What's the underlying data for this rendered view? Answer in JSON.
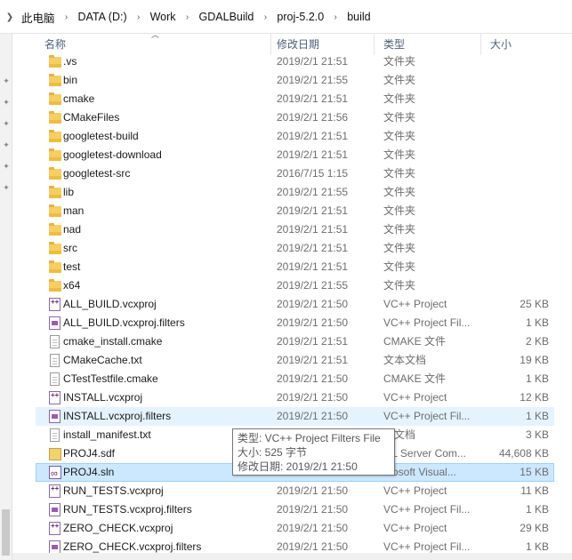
{
  "breadcrumb": {
    "items": [
      "此电脑",
      "DATA (D:)",
      "Work",
      "GDALBuild",
      "proj-5.2.0",
      "build"
    ]
  },
  "columns": {
    "name": "名称",
    "date": "修改日期",
    "type": "类型",
    "size": "大小"
  },
  "files": [
    {
      "name": ".vs",
      "date": "2019/2/1 21:51",
      "type": "文件夹",
      "size": "",
      "icon": "folder-icon"
    },
    {
      "name": "bin",
      "date": "2019/2/1 21:55",
      "type": "文件夹",
      "size": "",
      "icon": "folder-icon"
    },
    {
      "name": "cmake",
      "date": "2019/2/1 21:51",
      "type": "文件夹",
      "size": "",
      "icon": "folder-icon"
    },
    {
      "name": "CMakeFiles",
      "date": "2019/2/1 21:56",
      "type": "文件夹",
      "size": "",
      "icon": "folder-icon"
    },
    {
      "name": "googletest-build",
      "date": "2019/2/1 21:51",
      "type": "文件夹",
      "size": "",
      "icon": "folder-icon"
    },
    {
      "name": "googletest-download",
      "date": "2019/2/1 21:51",
      "type": "文件夹",
      "size": "",
      "icon": "folder-icon"
    },
    {
      "name": "googletest-src",
      "date": "2016/7/15 1:15",
      "type": "文件夹",
      "size": "",
      "icon": "folder-icon"
    },
    {
      "name": "lib",
      "date": "2019/2/1 21:55",
      "type": "文件夹",
      "size": "",
      "icon": "folder-icon"
    },
    {
      "name": "man",
      "date": "2019/2/1 21:51",
      "type": "文件夹",
      "size": "",
      "icon": "folder-icon"
    },
    {
      "name": "nad",
      "date": "2019/2/1 21:51",
      "type": "文件夹",
      "size": "",
      "icon": "folder-icon"
    },
    {
      "name": "src",
      "date": "2019/2/1 21:51",
      "type": "文件夹",
      "size": "",
      "icon": "folder-icon"
    },
    {
      "name": "test",
      "date": "2019/2/1 21:51",
      "type": "文件夹",
      "size": "",
      "icon": "folder-icon"
    },
    {
      "name": "x64",
      "date": "2019/2/1 21:55",
      "type": "文件夹",
      "size": "",
      "icon": "folder-icon"
    },
    {
      "name": "ALL_BUILD.vcxproj",
      "date": "2019/2/1 21:50",
      "type": "VC++ Project",
      "size": "25 KB",
      "icon": "vcxproj-icon"
    },
    {
      "name": "ALL_BUILD.vcxproj.filters",
      "date": "2019/2/1 21:50",
      "type": "VC++ Project Fil...",
      "size": "1 KB",
      "icon": "vcxproj-filters-icon"
    },
    {
      "name": "cmake_install.cmake",
      "date": "2019/2/1 21:51",
      "type": "CMAKE 文件",
      "size": "2 KB",
      "icon": "document-icon"
    },
    {
      "name": "CMakeCache.txt",
      "date": "2019/2/1 21:51",
      "type": "文本文档",
      "size": "19 KB",
      "icon": "document-icon"
    },
    {
      "name": "CTestTestfile.cmake",
      "date": "2019/2/1 21:50",
      "type": "CMAKE 文件",
      "size": "1 KB",
      "icon": "document-icon"
    },
    {
      "name": "INSTALL.vcxproj",
      "date": "2019/2/1 21:50",
      "type": "VC++ Project",
      "size": "12 KB",
      "icon": "vcxproj-icon"
    },
    {
      "name": "INSTALL.vcxproj.filters",
      "date": "2019/2/1 21:50",
      "type": "VC++ Project Fil...",
      "size": "1 KB",
      "icon": "vcxproj-filters-icon",
      "state": "hover"
    },
    {
      "name": "install_manifest.txt",
      "date": "",
      "type": "本文档",
      "size": "3 KB",
      "icon": "document-icon"
    },
    {
      "name": "PROJ4.sdf",
      "date": "",
      "type": "QL Server Com...",
      "size": "44,608 KB",
      "icon": "sdf-icon"
    },
    {
      "name": "PROJ4.sln",
      "date": "",
      "type": "crosoft Visual...",
      "size": "15 KB",
      "icon": "sln-icon",
      "state": "selected"
    },
    {
      "name": "RUN_TESTS.vcxproj",
      "date": "2019/2/1 21:50",
      "type": "VC++ Project",
      "size": "11 KB",
      "icon": "vcxproj-icon"
    },
    {
      "name": "RUN_TESTS.vcxproj.filters",
      "date": "2019/2/1 21:50",
      "type": "VC++ Project Fil...",
      "size": "1 KB",
      "icon": "vcxproj-filters-icon"
    },
    {
      "name": "ZERO_CHECK.vcxproj",
      "date": "2019/2/1 21:50",
      "type": "VC++ Project",
      "size": "29 KB",
      "icon": "vcxproj-icon"
    },
    {
      "name": "ZERO_CHECK.vcxproj.filters",
      "date": "2019/2/1 21:50",
      "type": "VC++ Project Fil...",
      "size": "1 KB",
      "icon": "vcxproj-filters-icon"
    }
  ],
  "tooltip": {
    "type_line": "类型: VC++ Project Filters File",
    "size_line": "大小: 525 字节",
    "date_line": "修改日期: 2019/2/1 21:50"
  },
  "colors": {
    "hover_row": "#e5f3ff",
    "selected_row": "#cce8ff",
    "selected_border": "#99d1ff",
    "header_text": "#4c607a"
  }
}
